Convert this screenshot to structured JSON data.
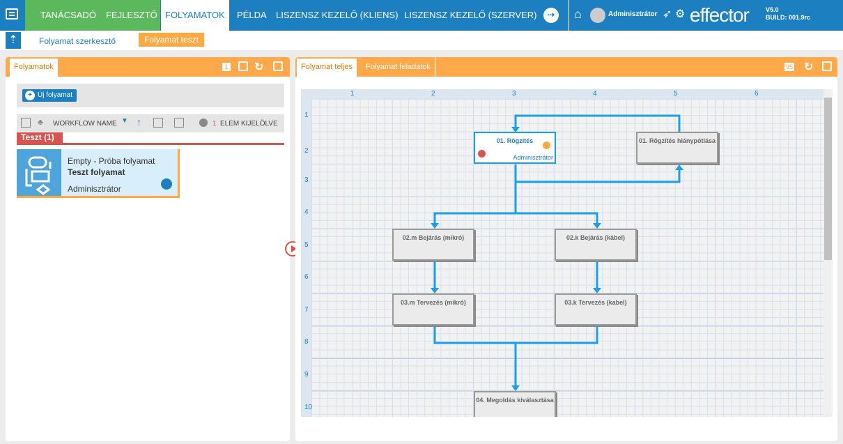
{
  "topnav": {
    "items": [
      "TANÁCSADÓ",
      "FEJLESZTŐ",
      "FOLYAMATOK",
      "PÉLDA",
      "LISZENSZ KEZELŐ (KLIENS)",
      "LISZENSZ KEZELŐ (SZERVER)"
    ],
    "user": "Adminisztrátor",
    "logo": "effector",
    "version": "V5.0",
    "build": "BUILD: 001.9rc"
  },
  "subnav": {
    "items": [
      "Folyamat szerkesztő",
      "Folyamat teszt"
    ]
  },
  "left": {
    "tab": "Folyamatok",
    "count": "1",
    "new_button": "Új folyamat",
    "sort_field": "WORKFLOW NAME",
    "selected_count": "1",
    "selected_label": "ELEM KIJELÖLVE",
    "group": "Teszt (1)",
    "card": {
      "line1": "Empty - Próba folyamat",
      "title": "Teszt folyamat",
      "owner": "Adminisztrátor"
    }
  },
  "right": {
    "tabs": [
      "Folyamat teljes",
      "Folyamat feladatok"
    ],
    "zoom": "95",
    "columns": [
      "1",
      "2",
      "3",
      "4",
      "5",
      "6"
    ],
    "rows": [
      "1",
      "2",
      "3",
      "4",
      "5",
      "6",
      "7",
      "8",
      "9",
      "10"
    ],
    "nodes": {
      "n1": "01. Rögzítés",
      "n1_owner": "Adminisztrátor",
      "n2": "01. Rögzítés hiánypótlása",
      "n3": "02.m Bejárás (mikró)",
      "n4": "02.k Bejárás (kábel)",
      "n5": "03.m Tervezés (mikró)",
      "n6": "03.k Tervezés (kabel)",
      "n7": "04. Megoldás kiválasztása"
    }
  },
  "colors": {
    "blue": "#1b7fc0",
    "green": "#5cb85c",
    "orange": "#ffa94a",
    "red": "#d9534f",
    "flow": "#1aa0e8"
  }
}
